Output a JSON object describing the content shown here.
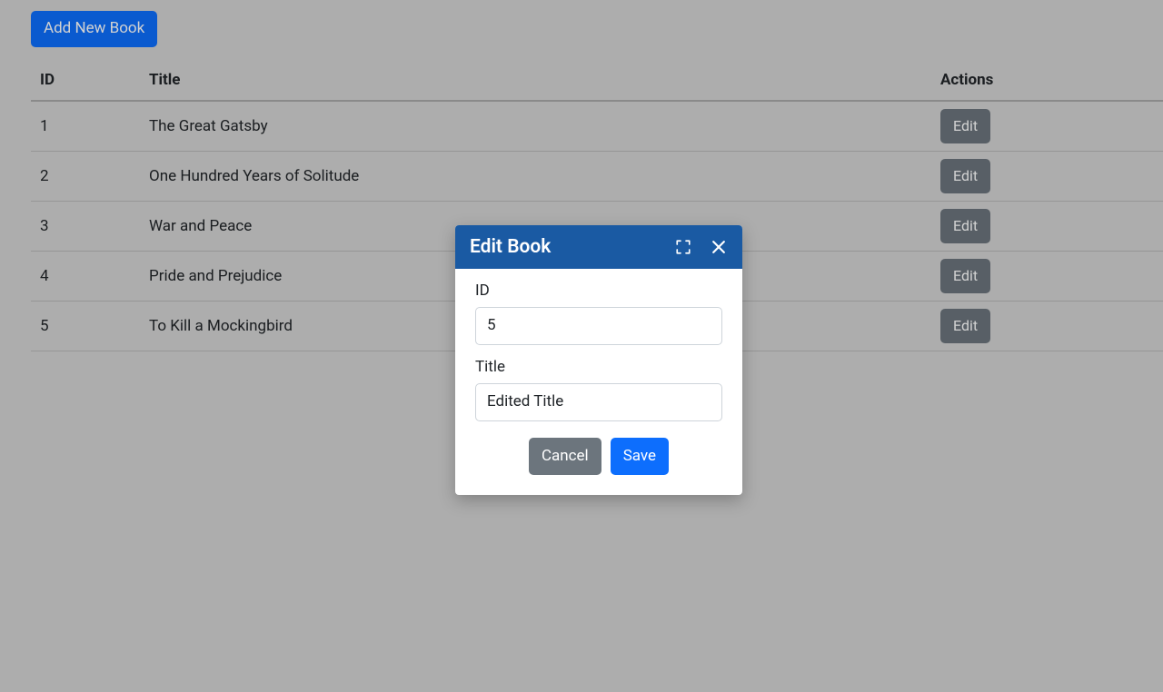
{
  "topButton": {
    "label": "Add New Book"
  },
  "table": {
    "headers": {
      "id": "ID",
      "title": "Title",
      "actions": "Actions"
    },
    "editLabel": "Edit",
    "rows": [
      {
        "id": "1",
        "title": "The Great Gatsby"
      },
      {
        "id": "2",
        "title": "One Hundred Years of Solitude"
      },
      {
        "id": "3",
        "title": "War and Peace"
      },
      {
        "id": "4",
        "title": "Pride and Prejudice"
      },
      {
        "id": "5",
        "title": "To Kill a Mockingbird"
      }
    ]
  },
  "modal": {
    "title": "Edit Book",
    "fields": {
      "idLabel": "ID",
      "idValue": "5",
      "titleLabel": "Title",
      "titleValue": "Edited Title"
    },
    "buttons": {
      "cancel": "Cancel",
      "save": "Save"
    }
  }
}
